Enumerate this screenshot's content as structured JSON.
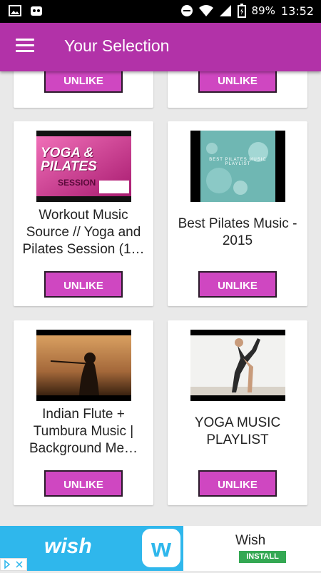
{
  "status": {
    "battery": "89%",
    "time": "13:52"
  },
  "appbar": {
    "title": "Your Selection"
  },
  "cards": [
    {
      "title": "",
      "button": "UNLIKE",
      "thumb": "none"
    },
    {
      "title": "",
      "button": "UNLIKE",
      "thumb": "none"
    },
    {
      "title": "Workout Music Source // Yoga and Pilates Session (1…",
      "button": "UNLIKE",
      "thumb": "yoga-pilates",
      "thumb_heading": "YOGA & PILATES",
      "thumb_sub": "SESSION"
    },
    {
      "title": "Best Pilates Music - 2015",
      "button": "UNLIKE",
      "thumb": "bokeh",
      "thumb_heading": "BEST PILATES MUSIC PLAYLIST"
    },
    {
      "title": "Indian Flute + Tumbura Music | Background Me…",
      "button": "UNLIKE",
      "thumb": "flute"
    },
    {
      "title": "YOGA MUSIC PLAYLIST",
      "button": "UNLIKE",
      "thumb": "yoga-pose"
    }
  ],
  "ad": {
    "brand": "wish",
    "name": "Wish",
    "install": "INSTALL"
  },
  "colors": {
    "appbar": "#b232a8",
    "button": "#cf47c1",
    "ad_blue": "#2fb7ec",
    "install_green": "#34a853"
  }
}
